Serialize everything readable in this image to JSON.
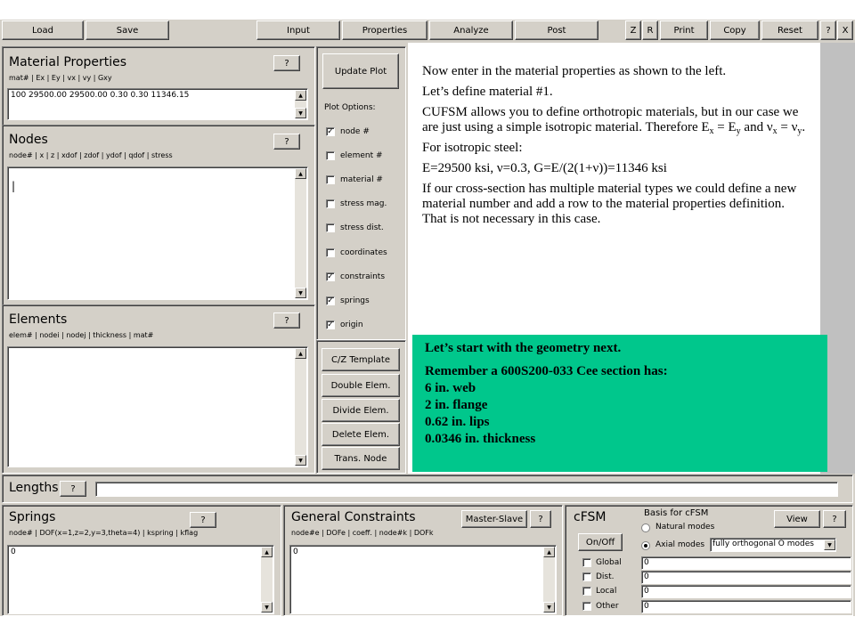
{
  "toolbar": {
    "load": "Load",
    "save": "Save",
    "input": "Input",
    "properties": "Properties",
    "analyze": "Analyze",
    "post": "Post",
    "z": "Z",
    "r": "R",
    "print": "Print",
    "copy": "Copy",
    "reset": "Reset",
    "help": "?",
    "close": "X"
  },
  "material": {
    "title": "Material Properties",
    "header": "mat# | Ex | Ey | vx | vy | Gxy",
    "value": "100 29500.00 29500.00 0.30 0.30 11346.15",
    "help": "?"
  },
  "nodes": {
    "title": "Nodes",
    "header": "node# | x | z | xdof | zdof | ydof | qdof | stress",
    "value": "|",
    "help": "?"
  },
  "elements": {
    "title": "Elements",
    "header": "elem# | nodei | nodej | thickness | mat#",
    "help": "?"
  },
  "plot": {
    "update": "Update Plot",
    "options_label": "Plot Options:",
    "options": [
      {
        "label": "node #",
        "checked": "✓"
      },
      {
        "label": "element #",
        "checked": ""
      },
      {
        "label": "material #",
        "checked": ""
      },
      {
        "label": "stress mag.",
        "checked": ""
      },
      {
        "label": "stress dist.",
        "checked": ""
      },
      {
        "label": "coordinates",
        "checked": ""
      },
      {
        "label": "constraints",
        "checked": "✓"
      },
      {
        "label": "springs",
        "checked": "✓"
      },
      {
        "label": "origin",
        "checked": "✓"
      }
    ]
  },
  "tools": {
    "cz_template": "C/Z Template",
    "double": "Double Elem.",
    "divide": "Divide Elem.",
    "delete": "Delete Elem.",
    "trans": "Trans. Node"
  },
  "lengths": {
    "label": "Lengths",
    "help": "?"
  },
  "springs": {
    "title": "Springs",
    "header": "node# | DOF(x=1,z=2,y=3,theta=4) | kspring | kflag",
    "value": "0",
    "help": "?"
  },
  "constraints": {
    "title": "General Constraints",
    "header": "node#e | DOFe | coeff. | node#k | DOFk",
    "value": "0",
    "master_slave": "Master-Slave",
    "help": "?"
  },
  "cfsm": {
    "title": "cFSM",
    "basis_label": "Basis for cFSM",
    "view": "View",
    "help": "?",
    "onoff": "On/Off",
    "natural": "Natural modes",
    "axial": "Axial modes",
    "mode_select": "fully orthogonal O modes",
    "rows": [
      {
        "label": "Global",
        "value": "0"
      },
      {
        "label": "Dist.",
        "value": "0"
      },
      {
        "label": "Local",
        "value": "0"
      },
      {
        "label": "Other",
        "value": "0"
      }
    ]
  },
  "instructions": {
    "p1": "Now enter in the material properties as shown to the left.",
    "p2": "Let’s define material #1.",
    "p3a": "CUFSM allows you to define orthotropic materials, but in our case we are just using a simple isotropic material. Therefore E",
    "p3_sub1": "x",
    "p3b": " = E",
    "p3_sub2": "y",
    "p3c": " and ν",
    "p3_sub3": "x",
    "p3d": " = ν",
    "p3_sub4": "y",
    "p3e": ".",
    "p4": "For isotropic steel:",
    "p5": "E=29500 ksi, ν=0.3, G=E/(2(1+ν))=11346 ksi",
    "p6": "If our cross-section has multiple material types we could define a new material number and add a row to the material properties definition. That is not necessary in this case."
  },
  "callout": {
    "line1": "Let’s start with the geometry next.",
    "line2": "Remember a 600S200-033 Cee section has:",
    "line3": "6 in. web",
    "line4": "2 in. flange",
    "line5": "0.62 in. lips",
    "line6": "0.0346 in. thickness"
  },
  "colors": {
    "callout_bg": "#00c78c",
    "window_bg": "#d4d0c8"
  }
}
